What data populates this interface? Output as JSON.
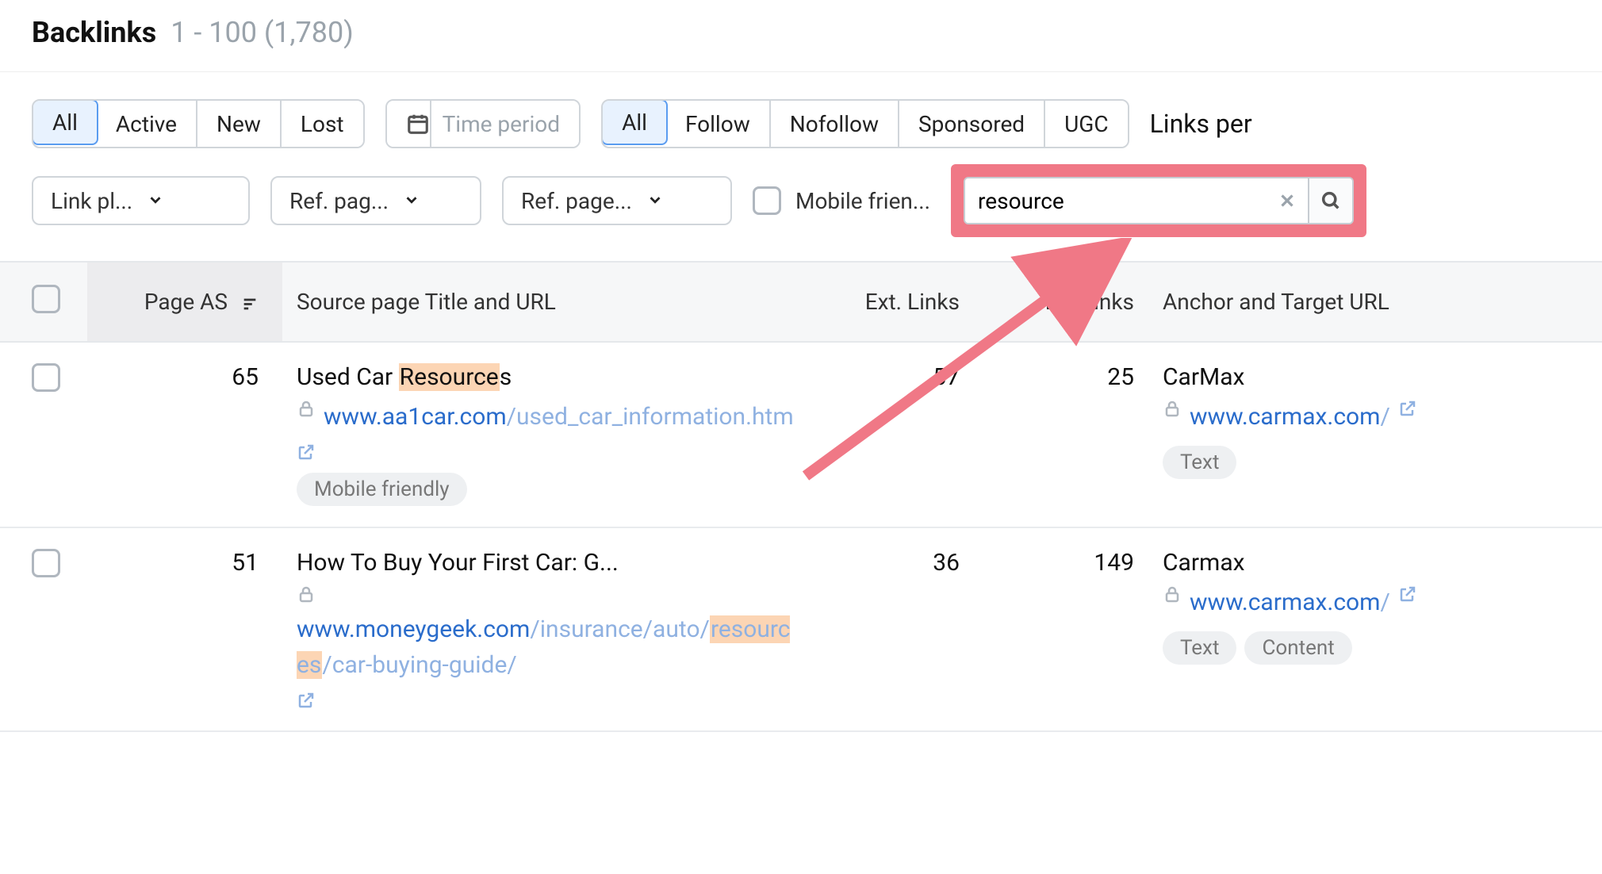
{
  "header": {
    "title": "Backlinks",
    "range": "1 - 100 (1,780)"
  },
  "toolbar": {
    "statusFilters": [
      "All",
      "Active",
      "New",
      "Lost"
    ],
    "statusActiveIndex": 0,
    "timePeriod": "Time period",
    "relFilters": [
      "All",
      "Follow",
      "Nofollow",
      "Sponsored",
      "UGC"
    ],
    "relActiveIndex": 0,
    "linksPer": "Links per",
    "drops": {
      "linkPlacement": "Link pl...",
      "refPage1": "Ref. pag...",
      "refPage2": "Ref. page..."
    },
    "mobileFriendly": "Mobile frien...",
    "search": {
      "value": "resource",
      "placeholder": ""
    }
  },
  "columns": {
    "pageAS": "Page AS",
    "source": "Source page Title and URL",
    "ext": "Ext. Links",
    "int": "Int. Links",
    "anchor": "Anchor and Target URL"
  },
  "rows": [
    {
      "as": "65",
      "title_pre": "Used Car ",
      "title_hl": "Resource",
      "title_post": "s",
      "lock": true,
      "url_domain": "www.aa1car.com",
      "url_path": "/used_car_information.htm",
      "src_badges": [
        "Mobile friendly"
      ],
      "ext": "57",
      "int": "25",
      "anchor": "CarMax",
      "target_domain": "www.carmax.com",
      "target_path": "/",
      "anchor_badges": [
        "Text"
      ]
    },
    {
      "as": "51",
      "title_pre": "How To Buy Your First Car: G...",
      "title_hl": "",
      "title_post": "",
      "lock": true,
      "url_domain": "www.moneygeek.com",
      "url_path": "/insurance/auto/resources/car-buying-guide/",
      "src_badges": [],
      "ext": "36",
      "int": "149",
      "anchor": "Carmax",
      "target_domain": "www.carmax.com",
      "target_path": "/",
      "anchor_badges": [
        "Text",
        "Content"
      ]
    }
  ]
}
